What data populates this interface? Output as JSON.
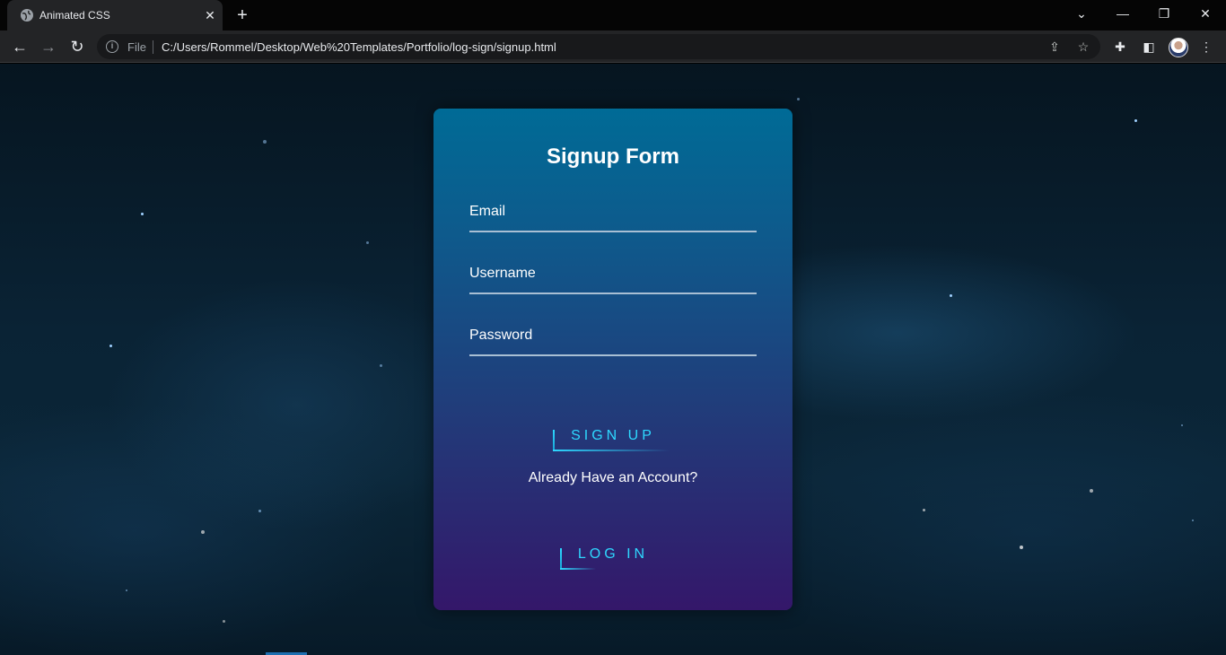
{
  "browser": {
    "tab_title": "Animated CSS",
    "new_tab_label": "+",
    "scheme_label": "File",
    "url": "C:/Users/Rommel/Desktop/Web%20Templates/Portfolio/log-sign/signup.html",
    "icons": [
      "globe-icon",
      "close-icon",
      "chevron-down-icon",
      "minimize-icon",
      "restore-icon",
      "close-window-icon",
      "back-icon",
      "forward-icon",
      "reload-icon",
      "info-icon",
      "share-icon",
      "star-icon",
      "extensions-icon",
      "side-panel-icon",
      "avatar",
      "more-icon"
    ]
  },
  "form": {
    "title": "Signup Form",
    "email_label": "Email",
    "username_label": "Username",
    "password_label": "Password",
    "signup_button": "SIGN UP",
    "already_text": "Already Have an Account?",
    "login_button": "LOG IN"
  },
  "colors": {
    "accent": "#2ed8ff",
    "card_top": "#006b96",
    "card_bottom": "#34176a"
  }
}
